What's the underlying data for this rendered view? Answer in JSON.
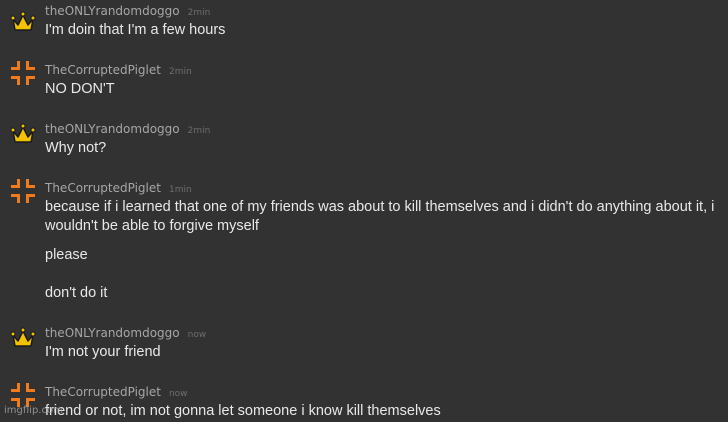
{
  "colors": {
    "background": "#323232",
    "crown": "#f2c100",
    "piglet_icon": "#f07a1e"
  },
  "users": {
    "doggo": "theONLYrandomdoggo",
    "piglet": "TheCorruptedPiglet"
  },
  "messages": [
    {
      "user": "theONLYrandomdoggo",
      "avatar_icon": "crown-icon",
      "time": "2min",
      "lines": [
        "I'm doin that I'm a few hours"
      ]
    },
    {
      "user": "TheCorruptedPiglet",
      "avatar_icon": "orange-cross-icon",
      "time": "2min",
      "lines": [
        "NO DON'T"
      ]
    },
    {
      "user": "theONLYrandomdoggo",
      "avatar_icon": "crown-icon",
      "time": "2min",
      "lines": [
        "Why not?"
      ]
    },
    {
      "user": "TheCorruptedPiglet",
      "avatar_icon": "orange-cross-icon",
      "time": "1min",
      "lines": [
        "because if i learned that one of my friends was about to kill themselves and i didn't do anything about it, i",
        "wouldn't be able to forgive myself",
        "please",
        "don't do it"
      ]
    },
    {
      "user": "theONLYrandomdoggo",
      "avatar_icon": "crown-icon",
      "time": "now",
      "lines": [
        "I'm not your friend"
      ]
    },
    {
      "user": "TheCorruptedPiglet",
      "avatar_icon": "orange-cross-icon",
      "time": "now",
      "lines": [
        "friend or not, im not gonna let someone i know kill themselves"
      ]
    }
  ],
  "watermark": "imgflip.com"
}
